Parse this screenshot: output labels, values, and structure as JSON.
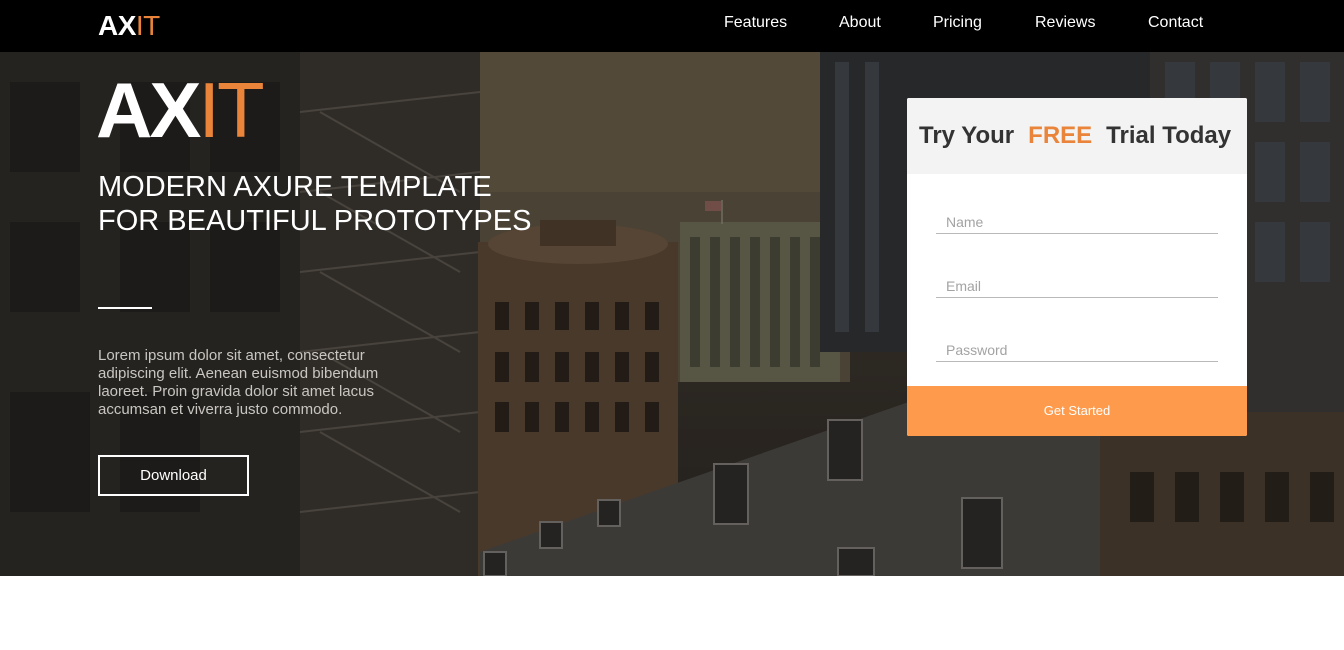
{
  "brand": {
    "logo_primary": "AX",
    "logo_accent": "IT",
    "accent_color": "#e9843a"
  },
  "nav": {
    "items": [
      {
        "label": "Features"
      },
      {
        "label": "About"
      },
      {
        "label": "Pricing"
      },
      {
        "label": "Reviews"
      },
      {
        "label": "Contact"
      }
    ]
  },
  "hero": {
    "logo_primary": "AX",
    "logo_accent": "IT",
    "title": "MODERN AXURE TEMPLATE FOR BEAUTIFUL PROTOTYPES",
    "body": "Lorem ipsum dolor sit amet, consectetur adipiscing elit. Aenean euismod bibendum laoreet. Proin gravida dolor sit amet lacus accumsan et viverra justo commodo.",
    "download_label": "Download"
  },
  "signup": {
    "title_before": "Try Your",
    "title_highlight": "FREE",
    "title_after": "Trial Today",
    "name_placeholder": "Name",
    "email_placeholder": "Email",
    "password_placeholder": "Password",
    "submit_label": "Get Started",
    "button_color": "#fe9a4c"
  }
}
